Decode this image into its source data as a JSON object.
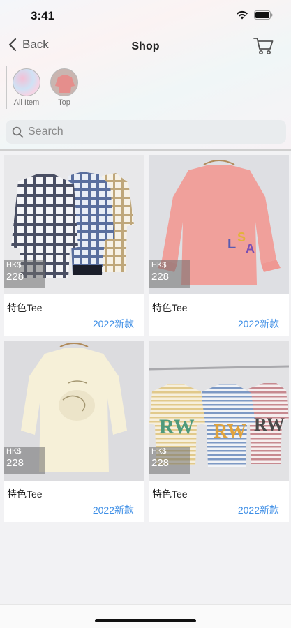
{
  "status_bar": {
    "time": "3:41"
  },
  "nav": {
    "back_label": "Back",
    "title": "Shop"
  },
  "categories": [
    {
      "label": "All Item"
    },
    {
      "label": "Top"
    }
  ],
  "search": {
    "placeholder": "Search"
  },
  "products": [
    {
      "currency": "HK$",
      "price": "228",
      "name": "特色Tee",
      "tag": "2022新款"
    },
    {
      "currency": "HK$",
      "price": "228",
      "name": "特色Tee",
      "tag": "2022新款"
    },
    {
      "currency": "HK$",
      "price": "228",
      "name": "特色Tee",
      "tag": "2022新款"
    },
    {
      "currency": "HK$",
      "price": "228",
      "name": "特色Tee",
      "tag": "2022新款"
    }
  ],
  "colors": {
    "accent": "#3d8ee6",
    "background": "#f2f2f4"
  }
}
